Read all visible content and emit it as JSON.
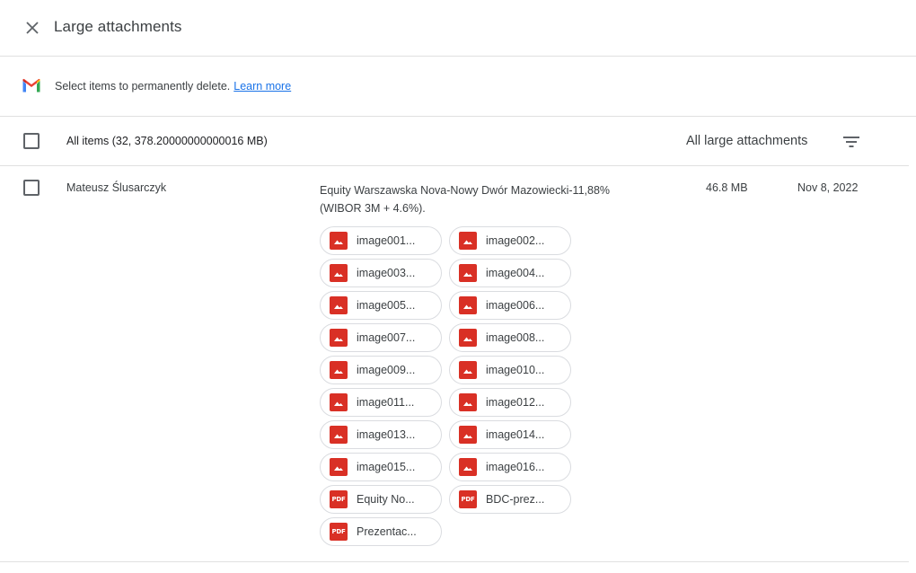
{
  "header": {
    "title": "Large attachments",
    "close_icon": "close-icon"
  },
  "info": {
    "text": "Select items to permanently delete.",
    "learn_more": "Learn more"
  },
  "list_header": {
    "all_items": "All items (32, 378.20000000000016 MB)",
    "filter_label": "All large attachments"
  },
  "row": {
    "sender": "Mateusz Ślusarczyk",
    "subject": "Equity Warszawska Nova-Nowy Dwór Mazowiecki-11,88% (WIBOR 3M + 4.6%).",
    "size": "46.8 MB",
    "date": "Nov 8, 2022",
    "attachments": [
      {
        "name": "image001...",
        "type": "image"
      },
      {
        "name": "image002...",
        "type": "image"
      },
      {
        "name": "image003...",
        "type": "image"
      },
      {
        "name": "image004...",
        "type": "image"
      },
      {
        "name": "image005...",
        "type": "image"
      },
      {
        "name": "image006...",
        "type": "image"
      },
      {
        "name": "image007...",
        "type": "image"
      },
      {
        "name": "image008...",
        "type": "image"
      },
      {
        "name": "image009...",
        "type": "image"
      },
      {
        "name": "image010...",
        "type": "image"
      },
      {
        "name": "image011...",
        "type": "image"
      },
      {
        "name": "image012...",
        "type": "image"
      },
      {
        "name": "image013...",
        "type": "image"
      },
      {
        "name": "image014...",
        "type": "image"
      },
      {
        "name": "image015...",
        "type": "image"
      },
      {
        "name": "image016...",
        "type": "image"
      },
      {
        "name": "Equity No...",
        "type": "pdf"
      },
      {
        "name": "BDC-prez...",
        "type": "pdf"
      },
      {
        "name": "Prezentac...",
        "type": "pdf"
      }
    ]
  },
  "pdf_badge": "PDF",
  "colors": {
    "accent": "#1a73e8",
    "file_icon": "#d93025",
    "divider": "#e0e0e0"
  }
}
